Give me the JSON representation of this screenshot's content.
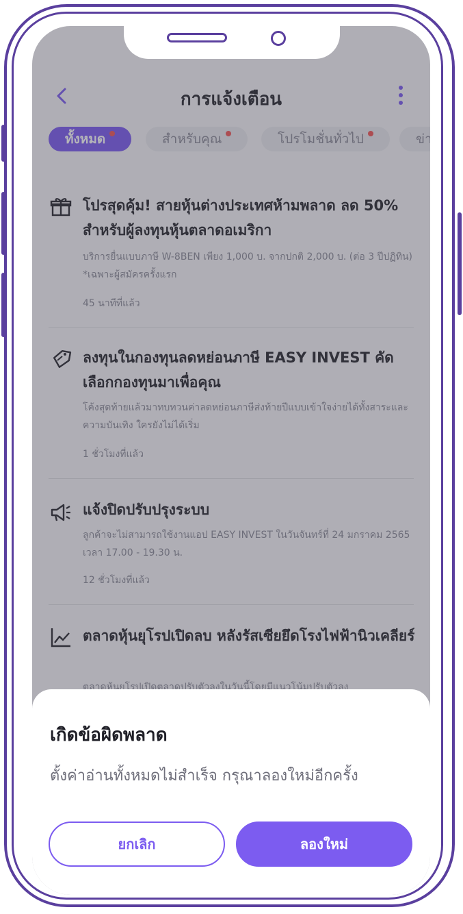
{
  "header": {
    "title": "การแจ้งเตือน"
  },
  "tabs": [
    {
      "label": "ทั้งหมด",
      "active": true,
      "dot": true
    },
    {
      "label": "สำหรับคุณ",
      "active": false,
      "dot": true
    },
    {
      "label": "โปรโมชั่นทั่วไป",
      "active": false,
      "dot": true
    },
    {
      "label": "ข่า",
      "active": false,
      "dot": false
    }
  ],
  "notifications": [
    {
      "icon": "gift-icon",
      "title": "โปรสุดคุ้ม! สายหุ้นต่างประเทศห้ามพลาด ลด 50% สำหรับผู้ลงทุนหุ้นตลาดอเมริกา",
      "desc": "บริการยื่นแบบภาษี W-8BEN เพียง 1,000 บ. จากปกติ 2,000 บ. (ต่อ 3 ปีปฏิทิน) *เฉพาะผู้สมัครครั้งแรก",
      "time": "45 นาทีที่แล้ว"
    },
    {
      "icon": "tax-tag-icon",
      "title": "ลงทุนในกองทุนลดหย่อนภาษี EASY INVEST คัดเลือกกองทุนมาเพื่อคุณ",
      "desc": "โค้งสุดท้ายแล้วมาทบทวนค่าลดหย่อนภาษีส่งท้ายปีแบบเข้าใจง่ายได้ทั้งสาระและความบันเทิง ใครยังไม่ได้เริ่ม",
      "time": "1 ชั่วโมงที่แล้ว"
    },
    {
      "icon": "megaphone-icon",
      "title": "แจ้งปิดปรับปรุงระบบ",
      "desc": "ลูกค้าจะไม่สามารถใช้งานแอป EASY INVEST ในวันจันทร์ที่ 24 มกราคม 2565 เวลา 17.00 - 19.30 น.",
      "time": "12 ชั่วโมงที่แล้ว"
    },
    {
      "icon": "chart-line-icon",
      "title": "ตลาดหุ้นยุโรปเปิดลบ หลังรัสเซียยึดโรงไฟฟ้านิวเคลียร์",
      "desc": "ตลาดหุ้นยุโรปเปิดตลาดปรับตัวลงในวันนี้โดยมีแนวโน้มปรับตัวลง",
      "time": ""
    }
  ],
  "dialog": {
    "title": "เกิดข้อผิดพลาด",
    "message": "ตั้งค่าอ่านทั้งหมดไม่สำเร็จ กรุณาลองใหม่อีกครั้ง",
    "cancel_label": "ยกเลิก",
    "retry_label": "ลองใหม่"
  },
  "colors": {
    "accent": "#7c5cf0",
    "frame": "#5a3f9e",
    "badge": "#f0585a"
  }
}
